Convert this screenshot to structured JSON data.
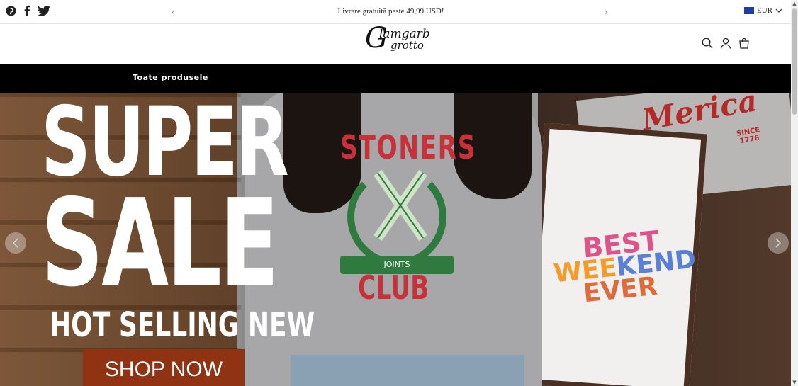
{
  "topbar": {
    "social": [
      "pinterest-icon",
      "facebook-icon",
      "twitter-icon"
    ],
    "prev_arrow": "‹",
    "next_arrow": "›",
    "announcement": "Livrare gratuită peste 49,99 USD!",
    "currency": "EUR"
  },
  "header": {
    "logo_line1": "lamgarb",
    "logo_line2": "grotto",
    "logo_initial": "G",
    "icons": [
      "search-icon",
      "account-icon",
      "cart-icon"
    ]
  },
  "nav": {
    "items": [
      "Toate produsele"
    ]
  },
  "hero": {
    "line_super": "SUPER",
    "line_sale": "SALE",
    "line_hot": "HOT SELLING NEW",
    "cta": "SHOP NOW",
    "shirt1_top": "STONERS",
    "shirt1_banner": "JOINTS",
    "shirt1_bottom": "CLUB",
    "shirt2_script": "Merica",
    "shirt2_since": "SINCE",
    "shirt2_year": "1776",
    "shirt3_line1": "BEST",
    "shirt3_line2a": "WEE",
    "shirt3_line2b": "KEND",
    "shirt3_line3": "EVER"
  },
  "colors": {
    "nav_bg": "#000000",
    "cta_bg": "#8f3313",
    "shirt_red": "#c7313a",
    "shirt_green": "#2f7a3e"
  }
}
